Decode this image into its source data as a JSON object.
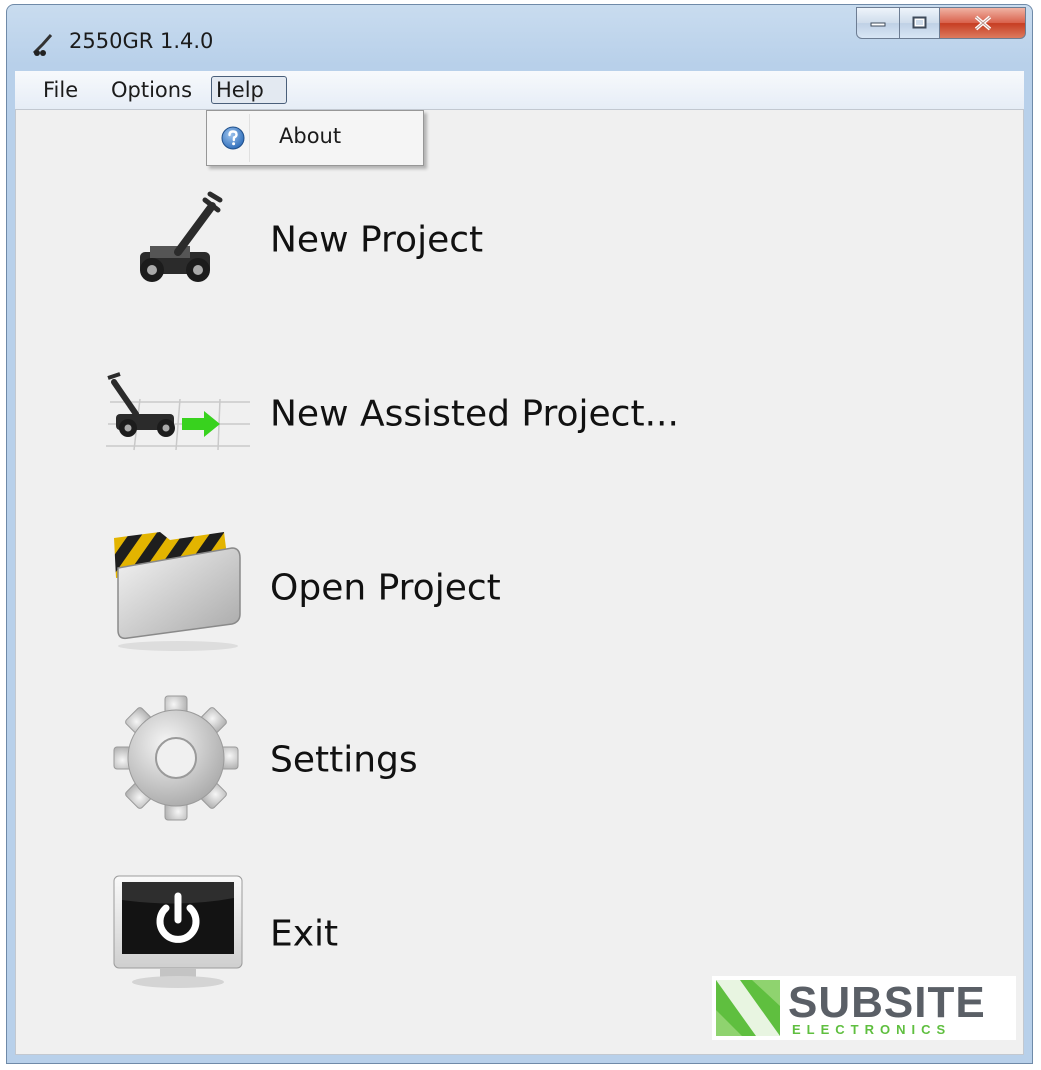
{
  "window": {
    "title": "2550GR 1.4.0"
  },
  "menubar": {
    "items": [
      "File",
      "Options",
      "Help"
    ],
    "active": "Help"
  },
  "help_menu": {
    "items": [
      {
        "label": "About",
        "icon": "help-circle-icon"
      }
    ]
  },
  "actions": [
    {
      "label": "New Project",
      "icon": "ground-radar-cart-icon"
    },
    {
      "label": "New Assisted Project...",
      "icon": "radar-cart-arrow-grid-icon"
    },
    {
      "label": "Open Project",
      "icon": "folder-hazard-stripes-icon"
    },
    {
      "label": "Settings",
      "icon": "gear-icon"
    },
    {
      "label": "Exit",
      "icon": "monitor-power-icon"
    }
  ],
  "logo": {
    "brand": "SUBSITE",
    "subtitle": "ELECTRONICS",
    "colors": {
      "green": "#5fbf3f",
      "gray": "#5a5f66"
    }
  }
}
